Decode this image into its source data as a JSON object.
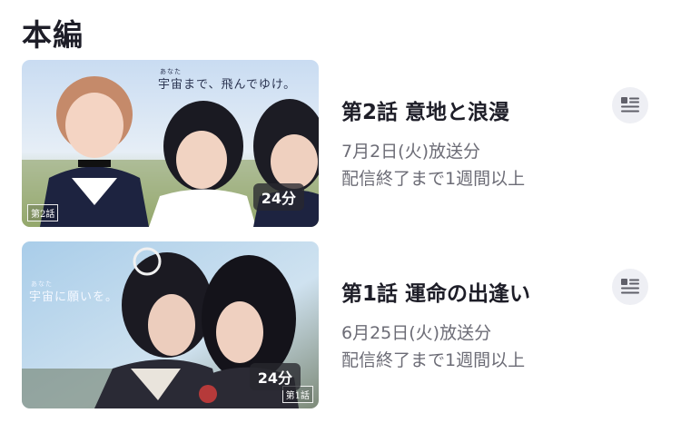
{
  "section": {
    "title": "本編"
  },
  "episodes": [
    {
      "title": "第2話 意地と浪漫",
      "air_date": "7月2日(火)放送分",
      "availability": "配信終了まで1週間以上",
      "duration": "24分",
      "thumb_label": "第2話",
      "thumb_tagline": "宇宙まで、飛んでゆけ。",
      "thumb_ruby": "あなた",
      "detail_icon": "details-list-icon"
    },
    {
      "title": "第1話 運命の出逢い",
      "air_date": "6月25日(火)放送分",
      "availability": "配信終了まで1週間以上",
      "duration": "24分",
      "thumb_label": "第1話",
      "thumb_tagline": "宇宙に願いを。",
      "thumb_ruby": "あなた",
      "detail_icon": "details-list-icon"
    }
  ]
}
